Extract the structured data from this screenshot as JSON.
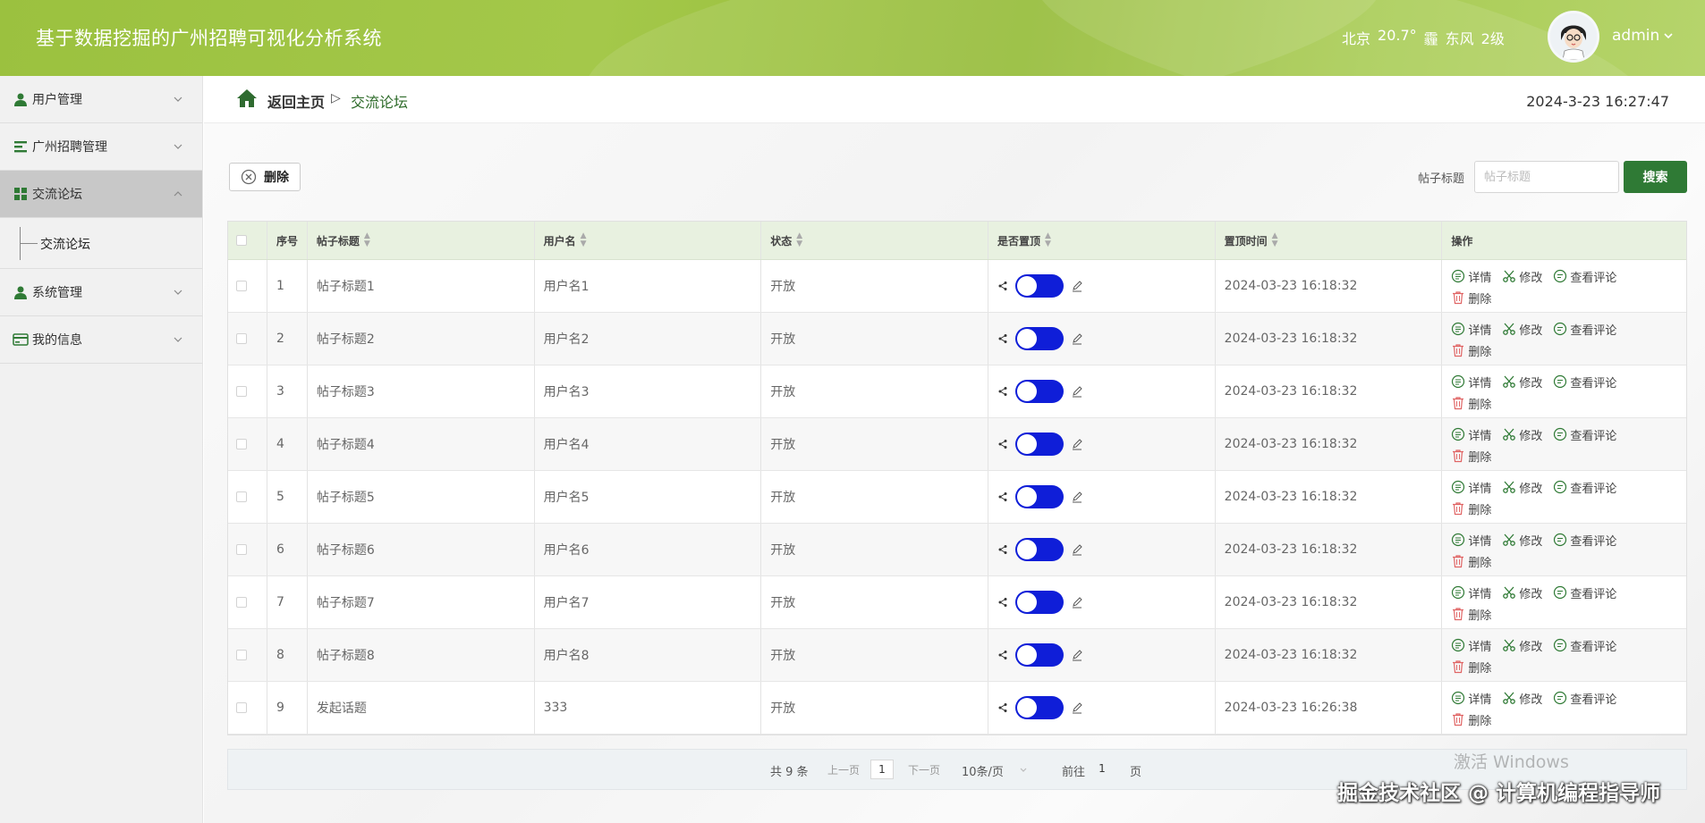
{
  "header": {
    "title": "基于数据挖掘的广州招聘可视化分析系统",
    "weather": {
      "city": "北京",
      "temp": "20.7°",
      "condition": "霾",
      "wind_dir": "东风",
      "wind_level": "2级"
    },
    "username": "admin",
    "dropdown_icon": "chevron-down-icon"
  },
  "sidebar": {
    "items": [
      {
        "label": "用户管理",
        "icon": "user-icon",
        "expanded": false
      },
      {
        "label": "广州招聘管理",
        "icon": "list-icon",
        "expanded": false
      },
      {
        "label": "交流论坛",
        "icon": "grid-icon",
        "expanded": true,
        "active": true
      },
      {
        "label": "系统管理",
        "icon": "user-icon",
        "expanded": false
      },
      {
        "label": "我的信息",
        "icon": "card-icon",
        "expanded": false
      }
    ],
    "submenu": {
      "label": "交流论坛"
    }
  },
  "breadcrumb": {
    "home": "返回主页",
    "separator": "▷",
    "current": "交流论坛"
  },
  "clock": "2024-3-23 16:27:47",
  "toolbar": {
    "delete_label": "删除",
    "search_label": "帖子标题",
    "search_placeholder": "帖子标题",
    "search_button": "搜索"
  },
  "table": {
    "headers": [
      "序号",
      "帖子标题",
      "用户名",
      "状态",
      "是否置顶",
      "置顶时间",
      "操作"
    ],
    "rows": [
      {
        "idx": "1",
        "title": "帖子标题1",
        "user": "用户名1",
        "status": "开放",
        "top_time": "2024-03-23 16:18:32"
      },
      {
        "idx": "2",
        "title": "帖子标题2",
        "user": "用户名2",
        "status": "开放",
        "top_time": "2024-03-23 16:18:32"
      },
      {
        "idx": "3",
        "title": "帖子标题3",
        "user": "用户名3",
        "status": "开放",
        "top_time": "2024-03-23 16:18:32"
      },
      {
        "idx": "4",
        "title": "帖子标题4",
        "user": "用户名4",
        "status": "开放",
        "top_time": "2024-03-23 16:18:32"
      },
      {
        "idx": "5",
        "title": "帖子标题5",
        "user": "用户名5",
        "status": "开放",
        "top_time": "2024-03-23 16:18:32"
      },
      {
        "idx": "6",
        "title": "帖子标题6",
        "user": "用户名6",
        "status": "开放",
        "top_time": "2024-03-23 16:18:32"
      },
      {
        "idx": "7",
        "title": "帖子标题7",
        "user": "用户名7",
        "status": "开放",
        "top_time": "2024-03-23 16:18:32"
      },
      {
        "idx": "8",
        "title": "帖子标题8",
        "user": "用户名8",
        "status": "开放",
        "top_time": "2024-03-23 16:18:32"
      },
      {
        "idx": "9",
        "title": "发起话题",
        "user": "333",
        "status": "开放",
        "top_time": "2024-03-23 16:26:38"
      }
    ],
    "ops": {
      "detail": "详情",
      "edit": "修改",
      "comments": "查看评论",
      "delete": "删除"
    },
    "toggle_color": "#0f1ed8"
  },
  "pagination": {
    "total": "共 9 条",
    "prev": "上一页",
    "page": "1",
    "next": "下一页",
    "page_size": "10条/页",
    "goto_label": "前往",
    "goto_value": "1",
    "goto_suffix": "页"
  },
  "overlays": {
    "windows_activate": "激活 Windows",
    "watermark": "掘金技术社区 @ 计算机编程指导师"
  },
  "colors": {
    "header_green": "#9bc13f",
    "primary": "#2f7a35",
    "toggle": "#0f1ed8"
  }
}
